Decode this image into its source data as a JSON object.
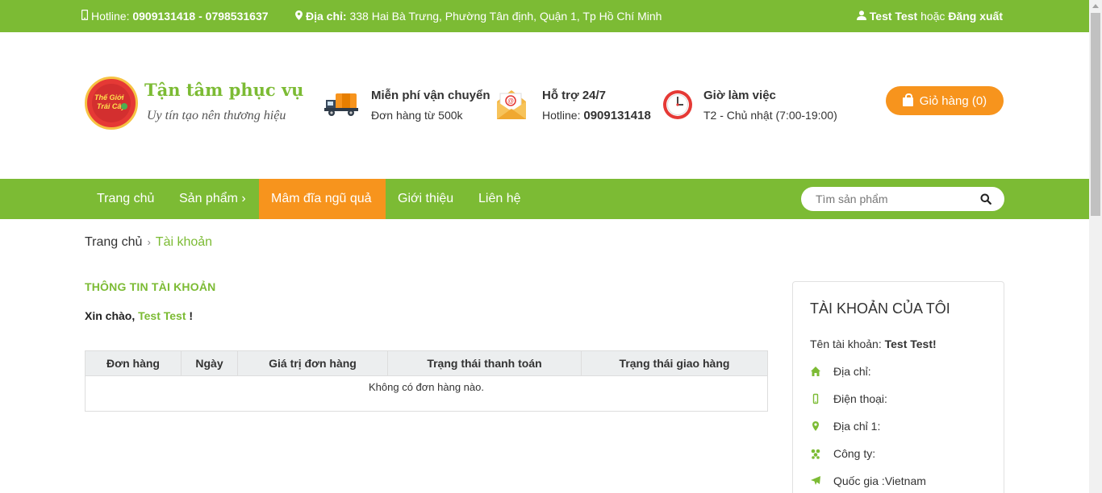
{
  "topbar": {
    "hotline_label": "Hotline:",
    "hotline_value": "0909131418 - 0798531637",
    "address_label": "Địa chỉ:",
    "address_value": "338 Hai Bà Trưng, Phường Tân định, Quận 1, Tp Hồ Chí Minh",
    "user_name": "Test Test",
    "or_text": "hoặc",
    "logout": "Đăng xuất"
  },
  "header": {
    "logo_text_1": "Thế Giới",
    "logo_text_2": "Trái Cây",
    "slogan_title": "Tận tâm phục vụ",
    "slogan_sub": "Uy tín tạo nên thương hiệu",
    "features": [
      {
        "title": "Miễn phí vận chuyển",
        "sub": "Đơn hàng từ 500k",
        "icon": "delivery-truck-icon"
      },
      {
        "title": "Hỗ trợ 24/7",
        "sub_label": "Hotline:",
        "sub_value": "0909131418",
        "icon": "email-support-icon"
      },
      {
        "title": "Giờ làm việc",
        "sub": "T2 - Chủ nhật (7:00-19:00)",
        "icon": "clock-icon"
      }
    ],
    "cart_label": "Giỏ hàng (0)"
  },
  "nav": {
    "items": [
      {
        "label": "Trang chủ"
      },
      {
        "label": "Sản phẩm ›"
      },
      {
        "label": "Mâm đĩa ngũ quả"
      },
      {
        "label": "Giới thiệu"
      },
      {
        "label": "Liên hệ"
      }
    ],
    "search_placeholder": "Tìm sản phẩm"
  },
  "breadcrumb": {
    "home": "Trang chủ",
    "separator": "›",
    "current": "Tài khoản"
  },
  "account": {
    "section_title": "THÔNG TIN TÀI KHOẢN",
    "greeting_prefix": "Xin chào,",
    "greeting_name": "Test Test",
    "greeting_suffix": "!",
    "table": {
      "headers": [
        "Đơn hàng",
        "Ngày",
        "Giá trị đơn hàng",
        "Trạng thái thanh toán",
        "Trạng thái giao hàng"
      ],
      "empty_message": "Không có đơn hàng nào."
    }
  },
  "sidebar": {
    "title": "TÀI KHOẢN CỦA TÔI",
    "account_name_label": "Tên tài khoản:",
    "account_name_value": "Test Test!",
    "rows": [
      {
        "label": "Địa chỉ:",
        "icon": "home-icon"
      },
      {
        "label": "Điện thoại:",
        "icon": "mobile-icon"
      },
      {
        "label": "Địa chỉ 1:",
        "icon": "map-marker-icon"
      },
      {
        "label": "Công ty:",
        "icon": "building-icon"
      },
      {
        "label": "Quốc gia :Vietnam",
        "icon": "plane-icon"
      }
    ]
  },
  "colors": {
    "brand_green": "#7cbb34",
    "accent_orange": "#f7941d"
  }
}
